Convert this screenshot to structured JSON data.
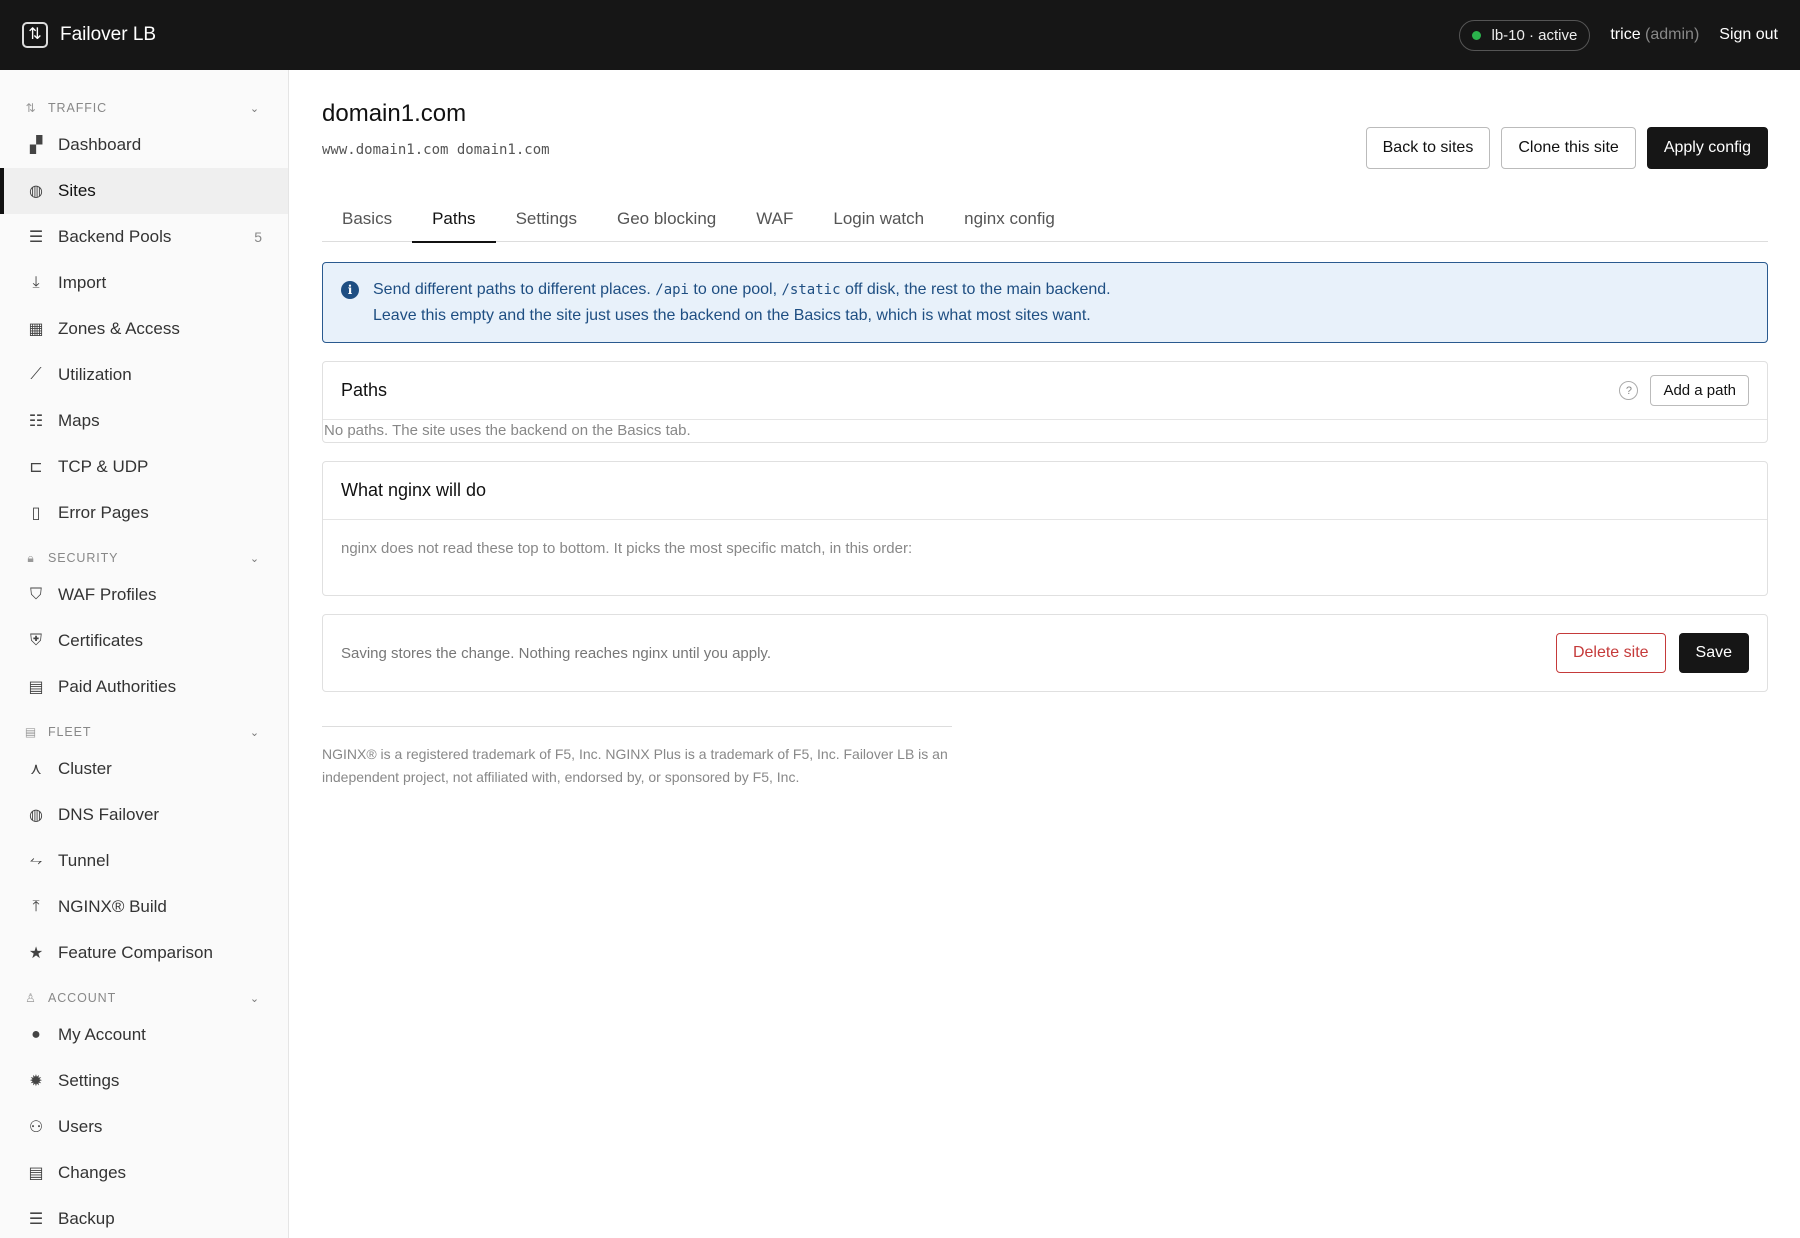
{
  "app": {
    "brand_icon": "arrows-updown-icon",
    "brand_icon_glyph": "⇅",
    "name": "Failover LB"
  },
  "topbar": {
    "status": "lb-10 · active",
    "user_name": "trice",
    "user_role": "(admin)",
    "sign_out": "Sign out",
    "status_color": "#2bb24c"
  },
  "sidebar": {
    "sections": [
      {
        "title": "TRAFFIC",
        "icon": "⇅",
        "items": [
          {
            "label": "Dashboard",
            "icon": "▞",
            "count": ""
          },
          {
            "label": "Sites",
            "icon": "◍",
            "count": "",
            "active": true
          },
          {
            "label": "Backend Pools",
            "icon": "☰",
            "count": "5"
          },
          {
            "label": "Import",
            "icon": "⤓",
            "count": ""
          },
          {
            "label": "Zones & Access",
            "icon": "▦",
            "count": ""
          },
          {
            "label": "Utilization",
            "icon": "⟋",
            "count": ""
          },
          {
            "label": "Maps",
            "icon": "☷",
            "count": ""
          },
          {
            "label": "TCP & UDP",
            "icon": "⊏",
            "count": ""
          },
          {
            "label": "Error Pages",
            "icon": "▯",
            "count": ""
          }
        ]
      },
      {
        "title": "SECURITY",
        "icon": "🔒︎",
        "items": [
          {
            "label": "WAF Profiles",
            "icon": "⛉",
            "count": ""
          },
          {
            "label": "Certificates",
            "icon": "⛨",
            "count": ""
          },
          {
            "label": "Paid Authorities",
            "icon": "▤",
            "count": ""
          }
        ]
      },
      {
        "title": "FLEET",
        "icon": "▤",
        "items": [
          {
            "label": "Cluster",
            "icon": "⋏",
            "count": ""
          },
          {
            "label": "DNS Failover",
            "icon": "◍",
            "count": ""
          },
          {
            "label": "Tunnel",
            "icon": "⥊",
            "count": ""
          },
          {
            "label": "NGINX® Build",
            "icon": "⤒",
            "count": ""
          },
          {
            "label": "Feature Comparison",
            "icon": "★",
            "count": ""
          }
        ]
      },
      {
        "title": "ACCOUNT",
        "icon": "♙",
        "items": [
          {
            "label": "My Account",
            "icon": "●",
            "count": ""
          },
          {
            "label": "Settings",
            "icon": "✹",
            "count": ""
          },
          {
            "label": "Users",
            "icon": "⚇",
            "count": ""
          },
          {
            "label": "Changes",
            "icon": "▤",
            "count": ""
          },
          {
            "label": "Backup",
            "icon": "☰",
            "count": ""
          }
        ]
      }
    ]
  },
  "page": {
    "title": "domain1.com",
    "subtitle": "www.domain1.com domain1.com",
    "back_button": "Back to sites",
    "clone_button": "Clone this site",
    "apply_button": "Apply config"
  },
  "tabs": [
    "Basics",
    "Paths",
    "Settings",
    "Geo blocking",
    "WAF",
    "Login watch",
    "nginx config"
  ],
  "active_tab": "Paths",
  "info": {
    "line1_a": "Send different paths to different places. ",
    "line1_code1": "/api",
    "line1_b": " to one pool, ",
    "line1_code2": "/static",
    "line1_c": " off disk, the rest to the main backend.",
    "line2": "Leave this empty and the site just uses the backend on the Basics tab, which is what most sites want."
  },
  "paths_card": {
    "title": "Paths",
    "help": "?",
    "add_button": "Add a path",
    "empty": "No paths. The site uses the backend on the Basics tab."
  },
  "nginx_card": {
    "title": "What nginx will do",
    "body": "nginx does not read these top to bottom. It picks the most specific match, in this order:"
  },
  "save_bar": {
    "text": "Saving stores the change. Nothing reaches nginx until you apply.",
    "delete_button": "Delete site",
    "save_button": "Save"
  },
  "footer": {
    "text": "NGINX® is a registered trademark of F5, Inc. NGINX Plus is a trademark of F5, Inc. Failover LB is an independent project, not affiliated with, endorsed by, or sponsored by F5, Inc."
  }
}
